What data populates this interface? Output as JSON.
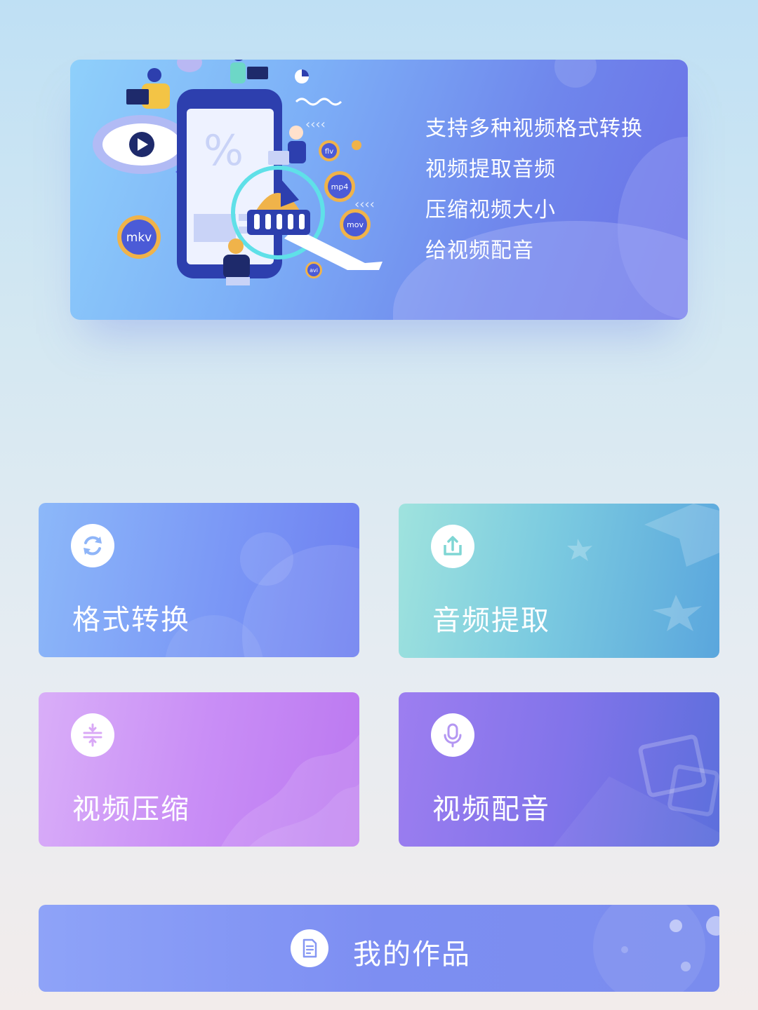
{
  "banner": {
    "lines": [
      "支持多种视频格式转换",
      "视频提取音频",
      "压缩视频大小",
      "给视频配音"
    ],
    "format_badges": [
      "mkv",
      "flv",
      "mp4",
      "mov",
      "avi"
    ]
  },
  "features": [
    {
      "label": "格式转换",
      "icon": "refresh-icon"
    },
    {
      "label": "音频提取",
      "icon": "export-icon"
    },
    {
      "label": "视频压缩",
      "icon": "compress-icon"
    },
    {
      "label": "视频配音",
      "icon": "microphone-icon"
    }
  ],
  "works": {
    "label": "我的作品",
    "icon": "document-icon"
  },
  "colors": {
    "banner_start": "#8fd0fb",
    "banner_end": "#6a6fe6",
    "card_convert": "#7b98f6",
    "card_extract": "#7ccbe0",
    "card_compress": "#c98ef6",
    "card_dub": "#8274ea",
    "works_bar": "#7d8ef2"
  }
}
